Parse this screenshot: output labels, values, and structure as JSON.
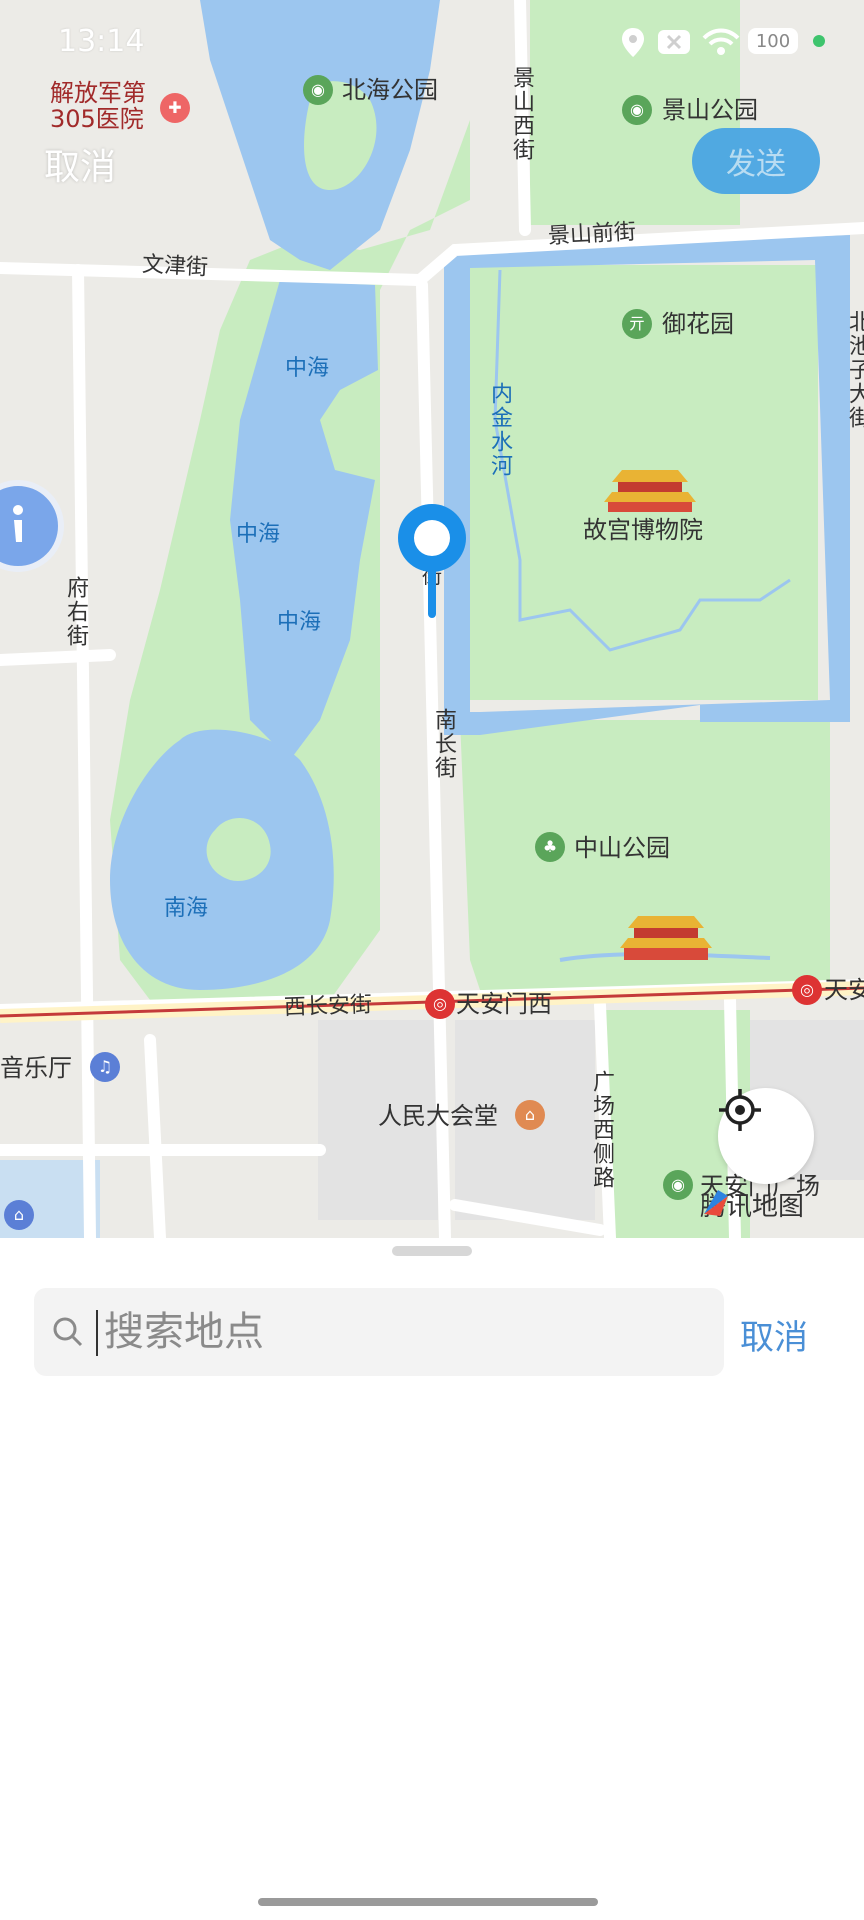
{
  "status_bar": {
    "time": "13:14",
    "battery": "100"
  },
  "top_bar": {
    "cancel_label": "取消",
    "send_label": "发送"
  },
  "map": {
    "labels": {
      "hospital": "解放军第\n305医院",
      "beihai_park": "北海公园",
      "jingshan_park": "景山公园",
      "jingshan_west": "景山西街",
      "jingshan_front": "景山前街",
      "wenjin": "文津街",
      "zhonghai_1": "中海",
      "zhonghai_2": "中海",
      "zhonghai_3": "中海",
      "nanhai": "南海",
      "yuhuayuan": "御花园",
      "neijinshuihe": "内金水河",
      "palace_museum": "故宫博物院",
      "beichi": "北池子大街",
      "fuyou": "府右街",
      "nanchang": "南长街",
      "zhongshan_park": "中山公园",
      "xichangan": "西长安街",
      "tiananmen_west": "天安门西",
      "tiananmen_east": "天安",
      "concert_hall": "音乐厅",
      "great_hall": "人民大会堂",
      "guangchang_west": "广场西侧路",
      "tiananmen_square": "天安门广场",
      "street_stub": "街"
    },
    "provider": "腾讯地图"
  },
  "search": {
    "placeholder": "搜索地点",
    "value": "",
    "cancel_label": "取消"
  },
  "colors": {
    "accent": "#4a8fd6",
    "pin": "#1a8fe8",
    "water": "#9cc6ef",
    "park": "#c8ecc0"
  }
}
